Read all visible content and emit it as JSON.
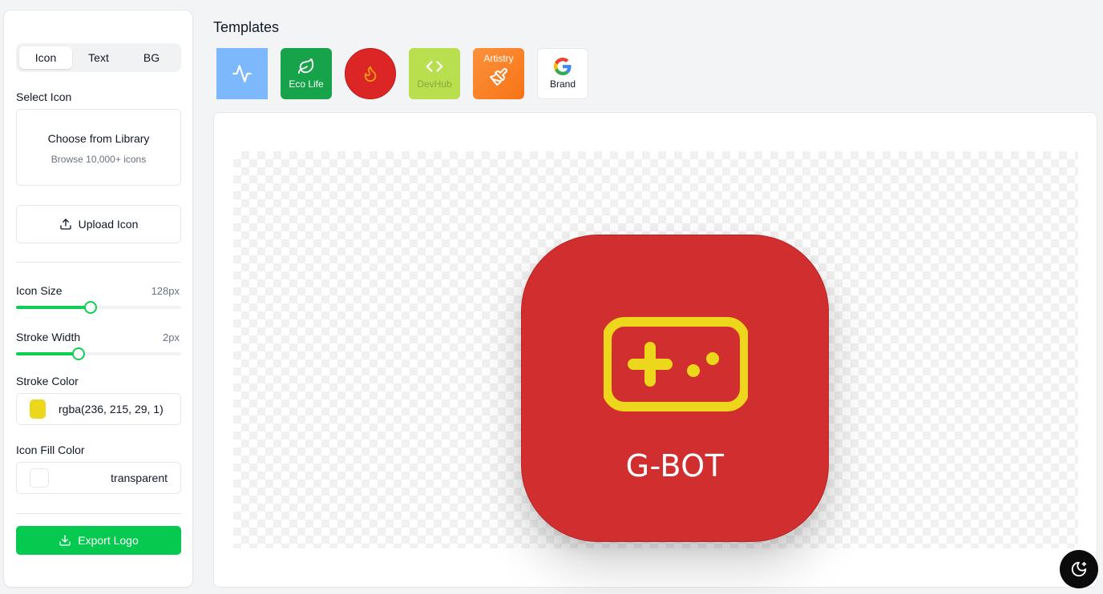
{
  "sidebar": {
    "tabs": [
      {
        "label": "Icon",
        "active": true
      },
      {
        "label": "Text",
        "active": false
      },
      {
        "label": "BG",
        "active": false
      }
    ],
    "select_icon_label": "Select Icon",
    "library": {
      "title": "Choose from Library",
      "subtitle": "Browse 10,000+ icons"
    },
    "upload_label": "Upload Icon",
    "icon_size": {
      "label": "Icon Size",
      "value": "128px",
      "fraction": 0.45
    },
    "stroke_width": {
      "label": "Stroke Width",
      "value": "2px",
      "fraction": 0.38
    },
    "stroke_color": {
      "label": "Stroke Color",
      "value": "rgba(236, 215, 29, 1)",
      "swatch": "#ecd71d"
    },
    "fill_color": {
      "label": "Icon Fill Color",
      "value": "transparent"
    },
    "export_label": "Export Logo"
  },
  "templates": {
    "title": "Templates",
    "items": [
      {
        "name": "",
        "icon": "activity-icon",
        "color": "#7cb8fb"
      },
      {
        "name": "Eco Life",
        "icon": "leaf-icon",
        "color": "#16a34a"
      },
      {
        "name": "",
        "icon": "flame-icon",
        "color": "#dc2626"
      },
      {
        "name": "DevHub",
        "icon": "code-icon",
        "color": "#b9df4f"
      },
      {
        "name": "Artistry",
        "icon": "paintbrush-icon",
        "color": "#f97316"
      },
      {
        "name": "Brand",
        "icon": "google-icon",
        "color": "#ffffff"
      }
    ]
  },
  "preview": {
    "logo_text": "G-BOT",
    "background": "#d12f2f",
    "icon": "gamepad-icon",
    "icon_color": "#ecd71d"
  },
  "theme_toggle_icon": "moon-sparkle-icon"
}
